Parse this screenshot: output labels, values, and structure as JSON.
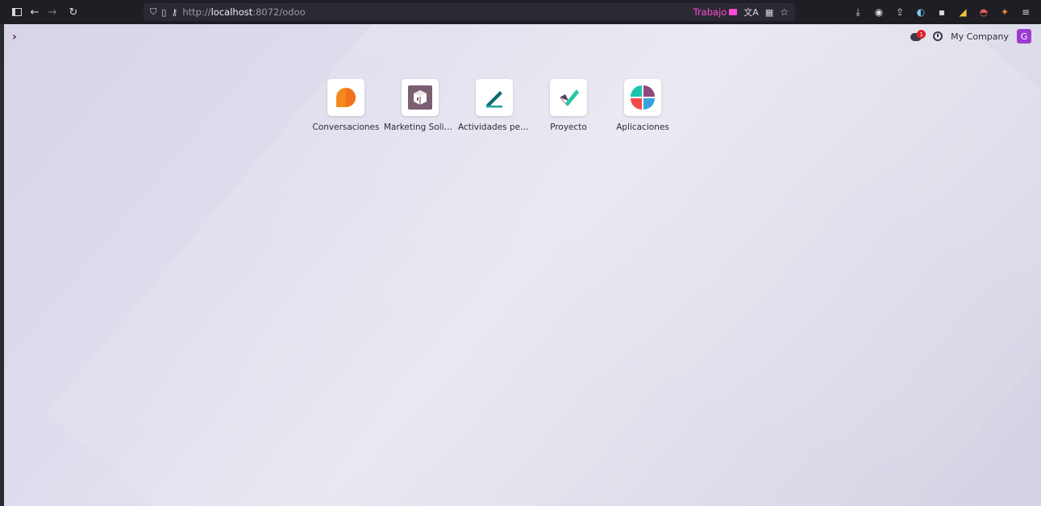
{
  "browser": {
    "url_prefix": "http://",
    "url_host": "localhost",
    "url_rest": ":8072/odoo",
    "container_label": "Trabajo"
  },
  "odoo": {
    "company": "My Company",
    "avatar_letter": "G",
    "chat_badge_count": "1"
  },
  "apps": [
    {
      "label": "Conversaciones",
      "icon": "chat-bubble-orange-icon"
    },
    {
      "label": "Marketing Solici...",
      "icon": "box-marketing-icon"
    },
    {
      "label": "Actividades pen...",
      "icon": "pen-activities-icon"
    },
    {
      "label": "Proyecto",
      "icon": "checkmark-project-icon"
    },
    {
      "label": "Aplicaciones",
      "icon": "apps-quad-icon"
    }
  ],
  "colors": {
    "accent_purple": "#9c3bd1",
    "container_pink": "#ff4bd8",
    "badge_red": "#e0212a"
  }
}
